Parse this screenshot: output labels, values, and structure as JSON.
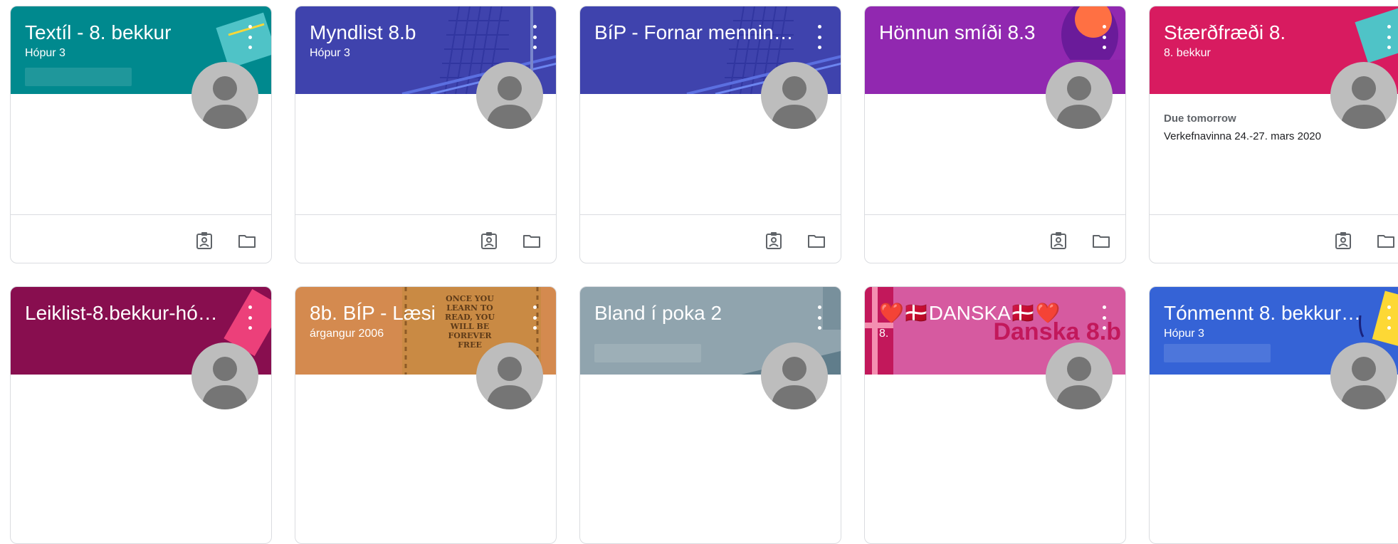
{
  "classes": [
    {
      "title": "Textíl - 8. bekkur",
      "subtitle": "Hópur 3",
      "color": "#009688",
      "menu": true
    },
    {
      "title": "Myndlist 8.b",
      "subtitle": "Hópur 3",
      "color": "#3f51b5",
      "menu": true
    },
    {
      "title": "BíP - Fornar menning...",
      "subtitle": "",
      "color": "#3f51b5",
      "menu": true
    },
    {
      "title": "Hönnun smíði 8.3",
      "subtitle": "",
      "color": "#9c27b0",
      "menu": true
    },
    {
      "title": "Stærðfræði 8.",
      "subtitle": "8. bekkur",
      "color": "#e91e63",
      "menu": true,
      "due": {
        "label": "Due tomorrow",
        "text": "Verkefnavinna 24.-27. mars 2020"
      }
    },
    {
      "title": "Leiklist-8.bekkur-hóp...",
      "subtitle": "",
      "color": "#8e1c5a",
      "menu": true
    },
    {
      "title": "8b. BÍP - Læsi",
      "subtitle": "árgangur 2006",
      "color": "#d48a4f",
      "menu": true
    },
    {
      "title": "Bland í poka 2",
      "subtitle": "",
      "color": "#90a4ae",
      "menu": true
    },
    {
      "title": "❤️🇩🇰DANSKA🇩🇰❤️",
      "subtitle": "8.",
      "color": "#d65aa0",
      "menu": true,
      "banner_text": "Danska 8.b"
    },
    {
      "title": "Tónmennt 8. bekkur 2...",
      "subtitle": "Hópur 3",
      "color": "#3d5fd9",
      "menu": true
    }
  ],
  "deco_text": {
    "poster": "ONCE YOU LEARN TO READ, YOU WILL BE FOREVER FREE"
  },
  "icons": {
    "work": "assignment-ind-icon",
    "folder": "folder-icon",
    "menu": "more-vert-icon",
    "avatar": "avatar-placeholder-icon"
  }
}
